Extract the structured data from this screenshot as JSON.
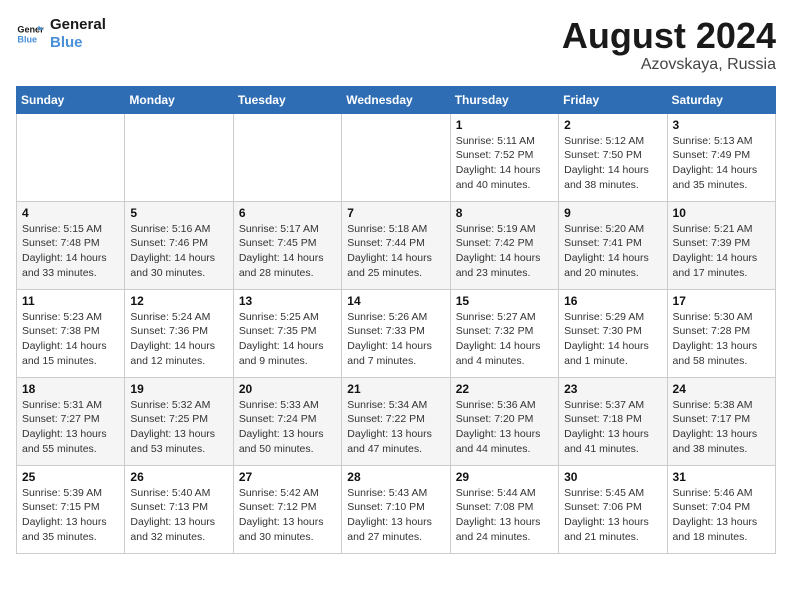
{
  "header": {
    "logo_line1": "General",
    "logo_line2": "Blue",
    "month_year": "August 2024",
    "location": "Azovskaya, Russia"
  },
  "weekdays": [
    "Sunday",
    "Monday",
    "Tuesday",
    "Wednesday",
    "Thursday",
    "Friday",
    "Saturday"
  ],
  "weeks": [
    [
      {
        "day": "",
        "info": ""
      },
      {
        "day": "",
        "info": ""
      },
      {
        "day": "",
        "info": ""
      },
      {
        "day": "",
        "info": ""
      },
      {
        "day": "1",
        "info": "Sunrise: 5:11 AM\nSunset: 7:52 PM\nDaylight: 14 hours\nand 40 minutes."
      },
      {
        "day": "2",
        "info": "Sunrise: 5:12 AM\nSunset: 7:50 PM\nDaylight: 14 hours\nand 38 minutes."
      },
      {
        "day": "3",
        "info": "Sunrise: 5:13 AM\nSunset: 7:49 PM\nDaylight: 14 hours\nand 35 minutes."
      }
    ],
    [
      {
        "day": "4",
        "info": "Sunrise: 5:15 AM\nSunset: 7:48 PM\nDaylight: 14 hours\nand 33 minutes."
      },
      {
        "day": "5",
        "info": "Sunrise: 5:16 AM\nSunset: 7:46 PM\nDaylight: 14 hours\nand 30 minutes."
      },
      {
        "day": "6",
        "info": "Sunrise: 5:17 AM\nSunset: 7:45 PM\nDaylight: 14 hours\nand 28 minutes."
      },
      {
        "day": "7",
        "info": "Sunrise: 5:18 AM\nSunset: 7:44 PM\nDaylight: 14 hours\nand 25 minutes."
      },
      {
        "day": "8",
        "info": "Sunrise: 5:19 AM\nSunset: 7:42 PM\nDaylight: 14 hours\nand 23 minutes."
      },
      {
        "day": "9",
        "info": "Sunrise: 5:20 AM\nSunset: 7:41 PM\nDaylight: 14 hours\nand 20 minutes."
      },
      {
        "day": "10",
        "info": "Sunrise: 5:21 AM\nSunset: 7:39 PM\nDaylight: 14 hours\nand 17 minutes."
      }
    ],
    [
      {
        "day": "11",
        "info": "Sunrise: 5:23 AM\nSunset: 7:38 PM\nDaylight: 14 hours\nand 15 minutes."
      },
      {
        "day": "12",
        "info": "Sunrise: 5:24 AM\nSunset: 7:36 PM\nDaylight: 14 hours\nand 12 minutes."
      },
      {
        "day": "13",
        "info": "Sunrise: 5:25 AM\nSunset: 7:35 PM\nDaylight: 14 hours\nand 9 minutes."
      },
      {
        "day": "14",
        "info": "Sunrise: 5:26 AM\nSunset: 7:33 PM\nDaylight: 14 hours\nand 7 minutes."
      },
      {
        "day": "15",
        "info": "Sunrise: 5:27 AM\nSunset: 7:32 PM\nDaylight: 14 hours\nand 4 minutes."
      },
      {
        "day": "16",
        "info": "Sunrise: 5:29 AM\nSunset: 7:30 PM\nDaylight: 14 hours\nand 1 minute."
      },
      {
        "day": "17",
        "info": "Sunrise: 5:30 AM\nSunset: 7:28 PM\nDaylight: 13 hours\nand 58 minutes."
      }
    ],
    [
      {
        "day": "18",
        "info": "Sunrise: 5:31 AM\nSunset: 7:27 PM\nDaylight: 13 hours\nand 55 minutes."
      },
      {
        "day": "19",
        "info": "Sunrise: 5:32 AM\nSunset: 7:25 PM\nDaylight: 13 hours\nand 53 minutes."
      },
      {
        "day": "20",
        "info": "Sunrise: 5:33 AM\nSunset: 7:24 PM\nDaylight: 13 hours\nand 50 minutes."
      },
      {
        "day": "21",
        "info": "Sunrise: 5:34 AM\nSunset: 7:22 PM\nDaylight: 13 hours\nand 47 minutes."
      },
      {
        "day": "22",
        "info": "Sunrise: 5:36 AM\nSunset: 7:20 PM\nDaylight: 13 hours\nand 44 minutes."
      },
      {
        "day": "23",
        "info": "Sunrise: 5:37 AM\nSunset: 7:18 PM\nDaylight: 13 hours\nand 41 minutes."
      },
      {
        "day": "24",
        "info": "Sunrise: 5:38 AM\nSunset: 7:17 PM\nDaylight: 13 hours\nand 38 minutes."
      }
    ],
    [
      {
        "day": "25",
        "info": "Sunrise: 5:39 AM\nSunset: 7:15 PM\nDaylight: 13 hours\nand 35 minutes."
      },
      {
        "day": "26",
        "info": "Sunrise: 5:40 AM\nSunset: 7:13 PM\nDaylight: 13 hours\nand 32 minutes."
      },
      {
        "day": "27",
        "info": "Sunrise: 5:42 AM\nSunset: 7:12 PM\nDaylight: 13 hours\nand 30 minutes."
      },
      {
        "day": "28",
        "info": "Sunrise: 5:43 AM\nSunset: 7:10 PM\nDaylight: 13 hours\nand 27 minutes."
      },
      {
        "day": "29",
        "info": "Sunrise: 5:44 AM\nSunset: 7:08 PM\nDaylight: 13 hours\nand 24 minutes."
      },
      {
        "day": "30",
        "info": "Sunrise: 5:45 AM\nSunset: 7:06 PM\nDaylight: 13 hours\nand 21 minutes."
      },
      {
        "day": "31",
        "info": "Sunrise: 5:46 AM\nSunset: 7:04 PM\nDaylight: 13 hours\nand 18 minutes."
      }
    ]
  ]
}
